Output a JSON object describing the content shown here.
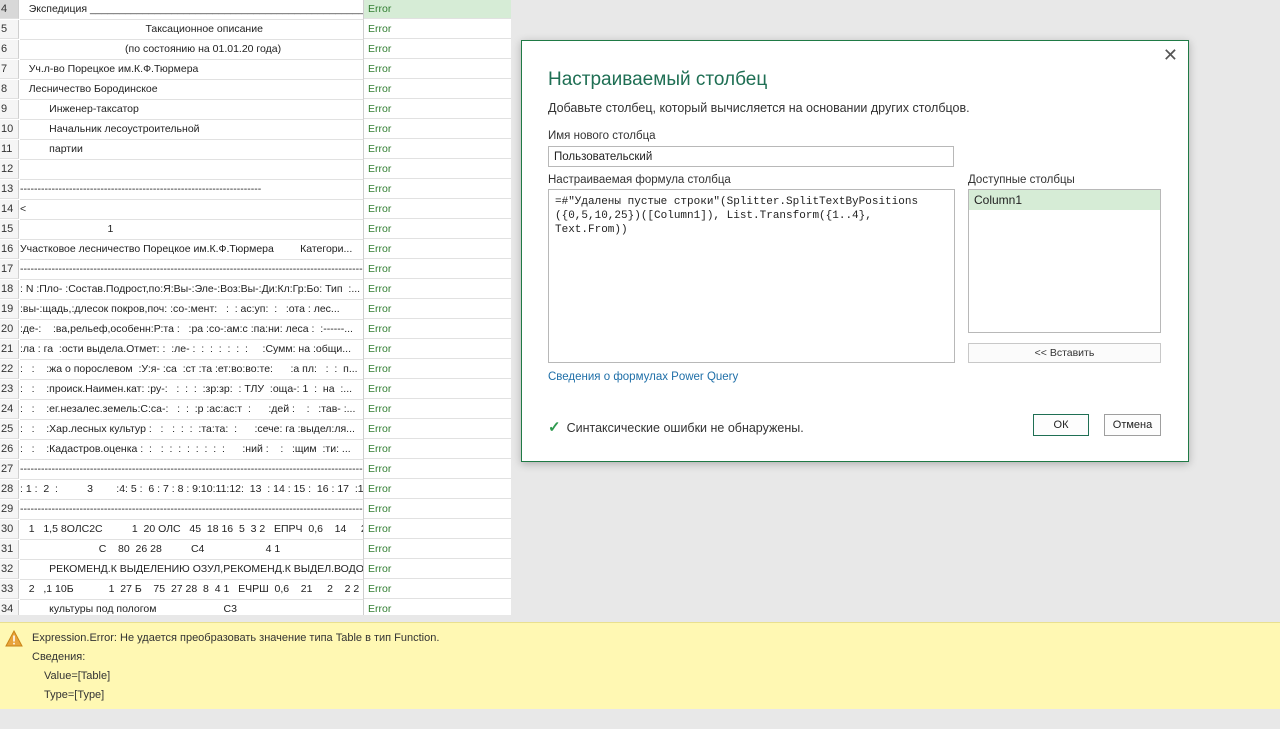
{
  "grid": {
    "rows": [
      {
        "num": "4",
        "text": "   Экспедиция _______________________________________________",
        "status": "Error",
        "selected": true
      },
      {
        "num": "5",
        "text": "                                           Таксационное описание",
        "status": "Error"
      },
      {
        "num": "6",
        "text": "                                    (по состоянию на 01.01.20 года)",
        "status": "Error"
      },
      {
        "num": "7",
        "text": "   Уч.л-во Порецкое им.К.Ф.Тюрмера",
        "status": "Error"
      },
      {
        "num": "8",
        "text": "   Лесничество Бородинское",
        "status": "Error"
      },
      {
        "num": "9",
        "text": "          Инженер-таксатор",
        "status": "Error"
      },
      {
        "num": "10",
        "text": "          Начальник лесоустроительной",
        "status": "Error"
      },
      {
        "num": "11",
        "text": "          партии",
        "status": "Error"
      },
      {
        "num": "12",
        "text": "",
        "status": "Error"
      },
      {
        "num": "13",
        "text": "---------------------------------------------------------------------",
        "status": "Error"
      },
      {
        "num": "14",
        "text": "<",
        "status": "Error"
      },
      {
        "num": "15",
        "text": "                              1",
        "status": "Error"
      },
      {
        "num": "16",
        "text": "Участковое лесничество Порецкое им.К.Ф.Тюрмера         Категори...",
        "status": "Error"
      },
      {
        "num": "17",
        "text": "---------------------------------------------------------------------------------------------------",
        "status": "Error"
      },
      {
        "num": "18",
        "text": ": N :Пло- :Состав.Подрост,по:Я:Вы-:Эле-:Воз:Вы-:Ди:Кл:Гр:Бо: Тип  :...",
        "status": "Error"
      },
      {
        "num": "19",
        "text": ":вы-:щадь,:длесок покров,поч: :со-:мент:   :  : ас:уп:  :   :ота : лес...",
        "status": "Error"
      },
      {
        "num": "20",
        "text": ":де-:    :ва,рельеф,особенн:Р:та :   :ра :со-:ам:с :па:ни: леса :  :------...",
        "status": "Error"
      },
      {
        "num": "21",
        "text": ":ла : га  :ости выдела.Отмет: :  :ле- :  :  :  :  :  :  :     :Сумм: на :общи...",
        "status": "Error"
      },
      {
        "num": "22",
        "text": ":   :    :жа о порослевом  :У:я- :са  :ст :та :ет:во:во:те:      :а пл:   :  :  п...",
        "status": "Error"
      },
      {
        "num": "23",
        "text": ":   :    :происк.Наимен.кат: :ру-:   :  :  :  :зр:зр:  : ТЛУ  :оща-: 1  :  на  :...",
        "status": "Error"
      },
      {
        "num": "24",
        "text": ":   :    :ег.незалес.земель:С:са-:   :  :  :р :ас:ас:т  :      :дей :    :   :тав- :...",
        "status": "Error"
      },
      {
        "num": "25",
        "text": ":   :    :Хар.лесных культур :   :   :  :  :  :та:та:  :      :сече: га :выдел:ля...",
        "status": "Error"
      },
      {
        "num": "26",
        "text": ":   :    :Кадастров.оценка :  :   :  :  :  :  :  :  :  :      :ний :    :   :щим  :ти: ...",
        "status": "Error"
      },
      {
        "num": "27",
        "text": "---------------------------------------------------------------------------------------------------",
        "status": "Error"
      },
      {
        "num": "28",
        "text": ": 1 :  2  :          3        :4: 5 :  6 : 7 : 8 : 9:10:11:12:  13  : 14 : 15 :  16 : 17  :1...",
        "status": "Error"
      },
      {
        "num": "29",
        "text": "---------------------------------------------------------------------------------------------------",
        "status": "Error"
      },
      {
        "num": "30",
        "text": "   1   1,5 8ОЛС2С          1  20 ОЛС   45  18 16  5  3 2   ЕПРЧ  0,6    14     2...",
        "status": "Error"
      },
      {
        "num": "31",
        "text": "                           С    80  26 28          С4                     4 1",
        "status": "Error"
      },
      {
        "num": "32",
        "text": "          РЕКОМЕНД.К ВЫДЕЛЕНИЮ ОЗУЛ,РЕКОМЕНД.К ВЫДЕЛ.ВОДО...",
        "status": "Error"
      },
      {
        "num": "33",
        "text": "   2   ,1 10Б            1  27 Б    75  27 28  8  4 1   ЕЧРШ  0,6    21     2    2 2",
        "status": "Error"
      },
      {
        "num": "34",
        "text": "          культуры под пологом                       С3",
        "status": "Error"
      }
    ]
  },
  "dialog": {
    "close_symbol": "✕",
    "title": "Настраиваемый столбец",
    "subtitle": "Добавьте столбец, который вычисляется на основании других столбцов.",
    "name_label": "Имя нового столбца",
    "name_value": "Пользовательский",
    "formula_label": "Настраиваемая формула столбца",
    "formula_value": "=#\"Удалены пустые строки\"(Splitter.SplitTextByPositions\n({0,5,10,25})([Column1]), List.Transform({1..4}, Text.From))",
    "available_label": "Доступные столбцы",
    "available_columns": [
      "Column1"
    ],
    "insert_button": "<< Вставить",
    "help_link": "Сведения о формулах Power Query",
    "status_text": "Синтаксические ошибки не обнаружены.",
    "ok_button": "ОК",
    "cancel_button": "Отмена"
  },
  "error_bar": {
    "line1": "Expression.Error: Не удается преобразовать значение типа Table в тип Function.",
    "line2": "Сведения:",
    "line3": "Value=[Table]",
    "line4": "Type=[Type]"
  },
  "colors": {
    "accent_green": "#1f6f54",
    "error_text": "#2f7d2f",
    "selected_cell": "#d6ecd6",
    "warning_bg": "#fff8b3",
    "link": "#1f6fa8"
  }
}
